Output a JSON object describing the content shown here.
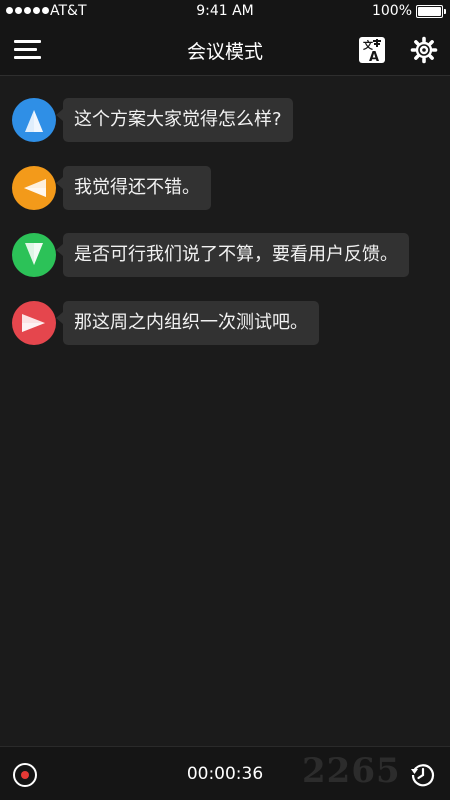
{
  "status_bar": {
    "carrier": "AT&T",
    "time": "9:41 AM",
    "battery": "100%",
    "battery_level": 1.0
  },
  "nav": {
    "title": "会议模式",
    "menu_icon": "hamburger-menu-icon",
    "translate_icon": "translate-icon",
    "settings_icon": "gear-icon"
  },
  "messages": [
    {
      "speaker_color": "#2f8fe6",
      "text": "这个方案大家觉得怎么样?"
    },
    {
      "speaker_color": "#f39a1a",
      "text": "我觉得还不错。"
    },
    {
      "speaker_color": "#2cc258",
      "text": "是否可行我们说了不算，要看用户反馈。"
    },
    {
      "speaker_color": "#e5464d",
      "text": "那这周之内组织一次测试吧。"
    }
  ],
  "bottom_bar": {
    "timer": "00:00:36",
    "record_color": "#e53935",
    "watermark": "2265",
    "history_icon": "clock-history-icon"
  }
}
